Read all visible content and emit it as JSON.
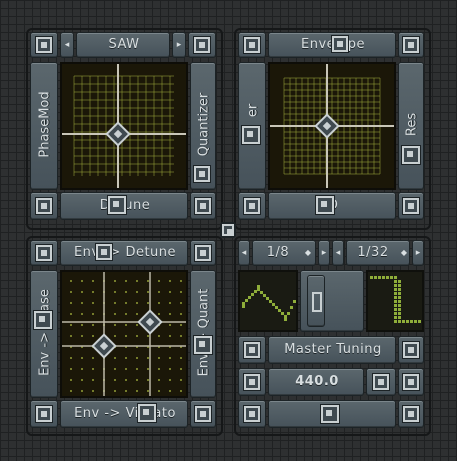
{
  "panels": {
    "top_left": {
      "waveform": "SAW",
      "left_label": "PhaseMod",
      "right_label": "Quantizer",
      "bottom_label": "Detune"
    },
    "top_right": {
      "top_label": "Envelope",
      "left_label": "er",
      "right_label": "Res",
      "bottom_label": "O"
    },
    "bottom_left": {
      "top_label": "Env -> Detune",
      "left_label": "Env -> Phase",
      "right_label": "Env -> Quant",
      "bottom_label": "Env -> Vibrato"
    },
    "bottom_right": {
      "rate_a": "1/8",
      "rate_b": "1/32",
      "tuning_label": "Master Tuning",
      "tuning_value": "440.0"
    }
  },
  "icons": {
    "handle": "square-handle-icon",
    "arrow_left": "arrow-left-icon",
    "arrow_right": "arrow-right-icon",
    "diamond": "diamond-handle-icon"
  },
  "colors": {
    "grid_line": "#9aa83a",
    "pad_bg": "#1b1708",
    "display_green": "#8fae3a",
    "panel": "#56626a",
    "text": "#d9dfe1"
  }
}
